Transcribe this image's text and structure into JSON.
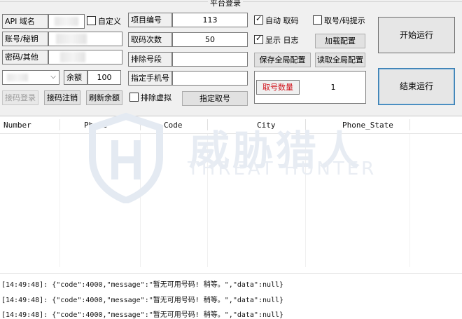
{
  "panel": {
    "title": "平台登录",
    "api_label": "API 域名",
    "custom_label": "自定义",
    "account_label": "账号/秘钥",
    "password_label": "密码/其他",
    "balance_label": "余额",
    "balance_value": "100",
    "btn_login": "接码登录",
    "btn_logout": "接码注销",
    "btn_refresh": "刷新余额",
    "project_label": "项目编号",
    "project_value": "113",
    "count_label": "取码次数",
    "count_value": "50",
    "exclude_label": "排除号段",
    "exclude_value": "",
    "phone_label": "指定手机号",
    "phone_value": "",
    "exclude_virtual_label": "排除虚拟",
    "btn_specify": "指定取号",
    "auto_label": "自动 取码",
    "hint_label": "取号/码提示",
    "show_log_label": "显示 日志",
    "btn_load_config": "加载配置",
    "btn_save_global": "保存全局配置",
    "btn_read_global": "读取全局配置",
    "num_count_label": "取号数量",
    "num_count_value": "1",
    "btn_start": "开始运行",
    "btn_stop": "结束运行"
  },
  "table": {
    "columns": [
      "Number",
      "Phone",
      "Code",
      "City",
      "Phone_State"
    ]
  },
  "watermark": {
    "cn": "威胁猎人",
    "en": "THREAT HUNTER"
  },
  "log": {
    "lines": [
      "[14:49:48]: {\"code\":4000,\"message\":\"暂无可用号码! 稍等。\",\"data\":null}",
      "[14:49:48]: {\"code\":4000,\"message\":\"暂无可用号码! 稍等。\",\"data\":null}",
      "[14:49:48]: {\"code\":4000,\"message\":\"暂无可用号码! 稍等。\",\"data\":null}"
    ]
  },
  "colors": {
    "accent_red": "#d0121b",
    "focus_blue": "#3c7fb1"
  }
}
